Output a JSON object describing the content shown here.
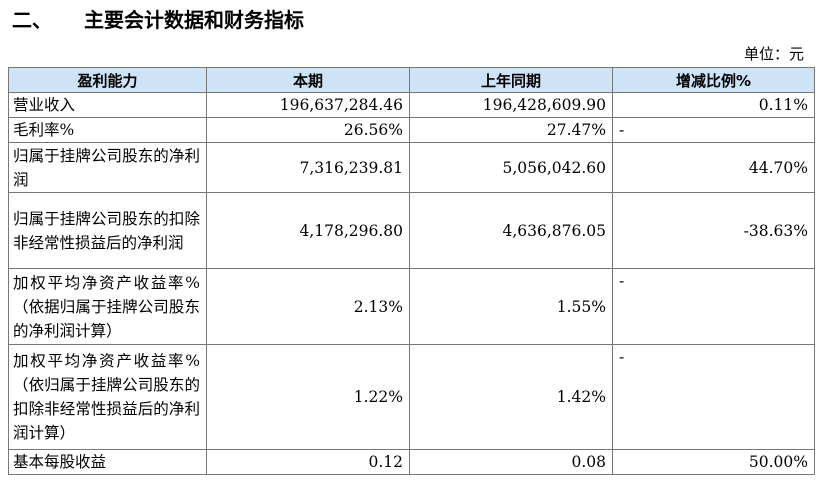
{
  "section": {
    "number": "二、",
    "title": "主要会计数据和财务指标"
  },
  "unit_label": "单位：元",
  "table": {
    "headers": [
      "盈利能力",
      "本期",
      "上年同期",
      "增减比例%"
    ],
    "rows": [
      {
        "label": "营业收入",
        "current": "196,637,284.46",
        "previous": "196,428,609.90",
        "change": "0.11%"
      },
      {
        "label": "毛利率%",
        "current": "26.56%",
        "previous": "27.47%",
        "change": "-"
      },
      {
        "label": "归属于挂牌公司股东的净利润",
        "current": "7,316,239.81",
        "previous": "5,056,042.60",
        "change": "44.70%"
      },
      {
        "label": "归属于挂牌公司股东的扣除非经常性损益后的净利润",
        "current": "4,178,296.80",
        "previous": "4,636,876.05",
        "change": "-38.63%"
      },
      {
        "label": "加权平均净资产收益率%（依据归属于挂牌公司股东的净利润计算）",
        "current": "2.13%",
        "previous": "1.55%",
        "change": "-"
      },
      {
        "label": "加权平均净资产收益率%（依归属于挂牌公司股东的扣除非经常性损益后的净利润计算）",
        "current": "1.22%",
        "previous": "1.42%",
        "change": "-"
      },
      {
        "label": "基本每股收益",
        "current": "0.12",
        "previous": "0.08",
        "change": "50.00%"
      }
    ]
  }
}
